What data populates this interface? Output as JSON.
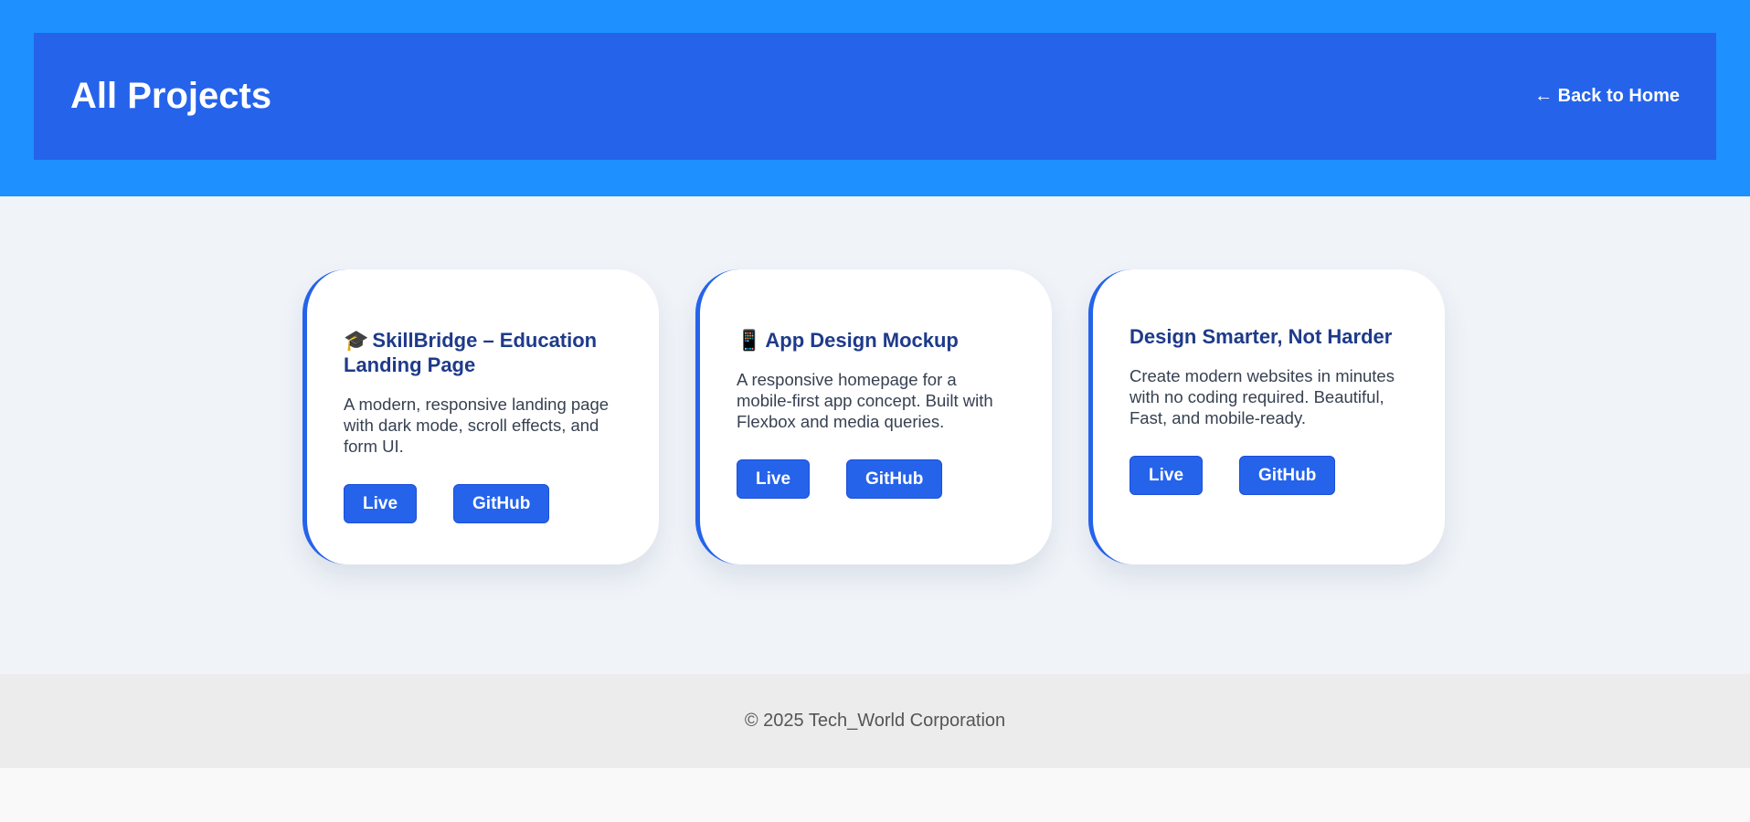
{
  "header": {
    "title": "All Projects",
    "back_link": "← Back to Home"
  },
  "projects": [
    {
      "emoji": "🎓",
      "title": "SkillBridge – Education Landing Page",
      "description": "A modern, responsive landing page with dark mode, scroll effects, and form UI.",
      "live_label": "Live",
      "github_label": "GitHub"
    },
    {
      "emoji": "📱",
      "title": "App Design Mockup",
      "description": "A responsive homepage for a mobile-first app concept. Built with Flexbox and media queries.",
      "live_label": "Live",
      "github_label": "GitHub"
    },
    {
      "emoji": "",
      "title": "Design Smarter, Not Harder",
      "description": "Create modern websites in minutes with no coding required. Beautiful, Fast, and mobile-ready.",
      "live_label": "Live",
      "github_label": "GitHub"
    }
  ],
  "footer": {
    "copyright": "© 2025 Tech_World Corporation"
  },
  "colors": {
    "top_band": "#1e90ff",
    "header": "#2563eb",
    "accent": "#2563eb",
    "card_title": "#1e3a8a",
    "main_bg": "#f0f4f9",
    "footer_bg": "#ececec"
  }
}
